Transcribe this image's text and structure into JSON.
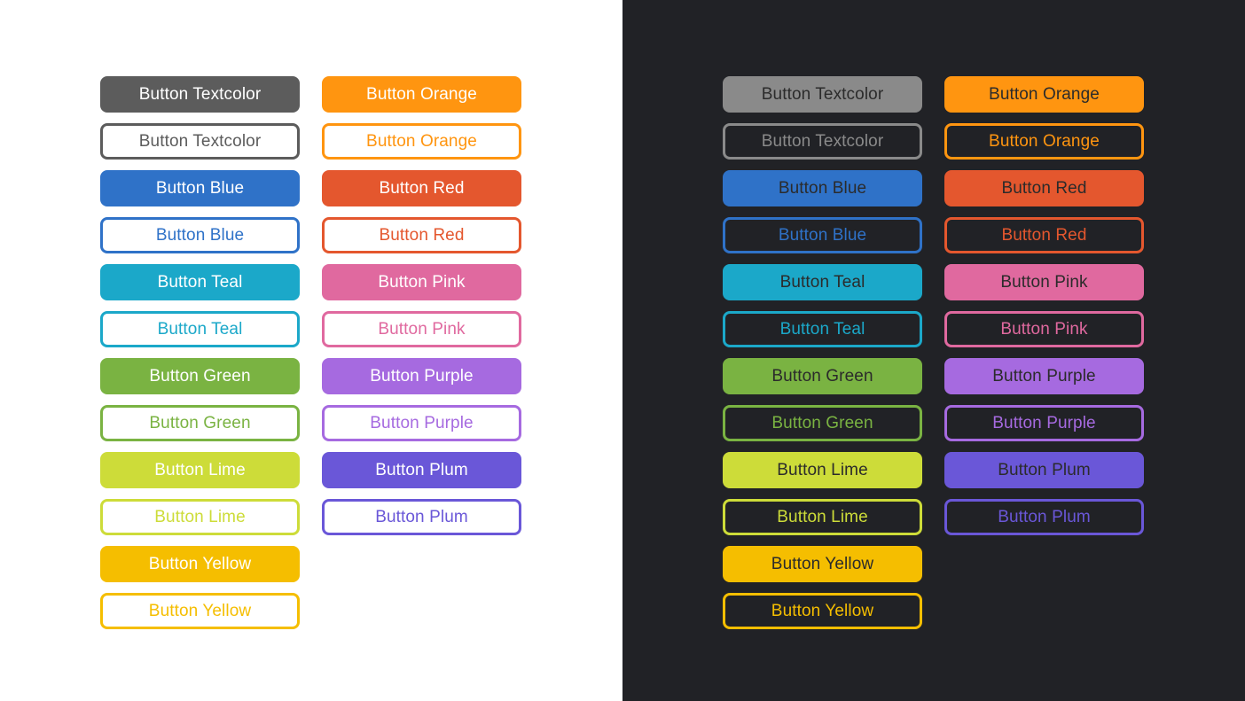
{
  "themes": [
    {
      "name": "light",
      "bg": "#ffffff",
      "solid_text": "#ffffff",
      "outline_bg": "#ffffff",
      "columns": [
        [
          {
            "label": "Button Textcolor",
            "style": "solid",
            "color": "#5c5c5c"
          },
          {
            "label": "Button Textcolor",
            "style": "outline",
            "color": "#5c5c5c"
          },
          {
            "label": "Button Blue",
            "style": "solid",
            "color": "#2f72c8"
          },
          {
            "label": "Button Blue",
            "style": "outline",
            "color": "#2f72c8"
          },
          {
            "label": "Button Teal",
            "style": "solid",
            "color": "#1ba8c9"
          },
          {
            "label": "Button Teal",
            "style": "outline",
            "color": "#1ba8c9"
          },
          {
            "label": "Button Green",
            "style": "solid",
            "color": "#7ab342"
          },
          {
            "label": "Button Green",
            "style": "outline",
            "color": "#7ab342"
          },
          {
            "label": "Button Lime",
            "style": "solid",
            "color": "#cddc39"
          },
          {
            "label": "Button Lime",
            "style": "outline",
            "color": "#cddc39"
          },
          {
            "label": "Button Yellow",
            "style": "solid",
            "color": "#f5be00"
          },
          {
            "label": "Button Yellow",
            "style": "outline",
            "color": "#f5be00"
          }
        ],
        [
          {
            "label": "Button Orange",
            "style": "solid",
            "color": "#ff9510"
          },
          {
            "label": "Button Orange",
            "style": "outline",
            "color": "#ff9510"
          },
          {
            "label": "Button Red",
            "style": "solid",
            "color": "#e4572e"
          },
          {
            "label": "Button Red",
            "style": "outline",
            "color": "#e4572e"
          },
          {
            "label": "Button Pink",
            "style": "solid",
            "color": "#e0699f"
          },
          {
            "label": "Button Pink",
            "style": "outline",
            "color": "#e0699f"
          },
          {
            "label": "Button Purple",
            "style": "solid",
            "color": "#a66ae0"
          },
          {
            "label": "Button Purple",
            "style": "outline",
            "color": "#a66ae0"
          },
          {
            "label": "Button Plum",
            "style": "solid",
            "color": "#6a57d8"
          },
          {
            "label": "Button Plum",
            "style": "outline",
            "color": "#6a57d8"
          }
        ]
      ]
    },
    {
      "name": "dark",
      "bg": "#212226",
      "solid_text": "#2b2b2b",
      "outline_bg": "#212226",
      "columns": [
        [
          {
            "label": "Button Textcolor",
            "style": "solid",
            "color": "#8a8a8a"
          },
          {
            "label": "Button Textcolor",
            "style": "outline",
            "color": "#8a8a8a"
          },
          {
            "label": "Button Blue",
            "style": "solid",
            "color": "#2f72c8"
          },
          {
            "label": "Button Blue",
            "style": "outline",
            "color": "#2f72c8"
          },
          {
            "label": "Button Teal",
            "style": "solid",
            "color": "#1ba8c9"
          },
          {
            "label": "Button Teal",
            "style": "outline",
            "color": "#1ba8c9"
          },
          {
            "label": "Button Green",
            "style": "solid",
            "color": "#7ab342"
          },
          {
            "label": "Button Green",
            "style": "outline",
            "color": "#7ab342"
          },
          {
            "label": "Button Lime",
            "style": "solid",
            "color": "#cddc39"
          },
          {
            "label": "Button Lime",
            "style": "outline",
            "color": "#cddc39"
          },
          {
            "label": "Button Yellow",
            "style": "solid",
            "color": "#f5be00"
          },
          {
            "label": "Button Yellow",
            "style": "outline",
            "color": "#f5be00"
          }
        ],
        [
          {
            "label": "Button Orange",
            "style": "solid",
            "color": "#ff9510"
          },
          {
            "label": "Button Orange",
            "style": "outline",
            "color": "#ff9510"
          },
          {
            "label": "Button Red",
            "style": "solid",
            "color": "#e4572e"
          },
          {
            "label": "Button Red",
            "style": "outline",
            "color": "#e4572e"
          },
          {
            "label": "Button Pink",
            "style": "solid",
            "color": "#e0699f"
          },
          {
            "label": "Button Pink",
            "style": "outline",
            "color": "#e0699f"
          },
          {
            "label": "Button Purple",
            "style": "solid",
            "color": "#a66ae0"
          },
          {
            "label": "Button Purple",
            "style": "outline",
            "color": "#a66ae0"
          },
          {
            "label": "Button Plum",
            "style": "solid",
            "color": "#6a57d8"
          },
          {
            "label": "Button Plum",
            "style": "outline",
            "color": "#6a57d8"
          }
        ]
      ]
    }
  ]
}
